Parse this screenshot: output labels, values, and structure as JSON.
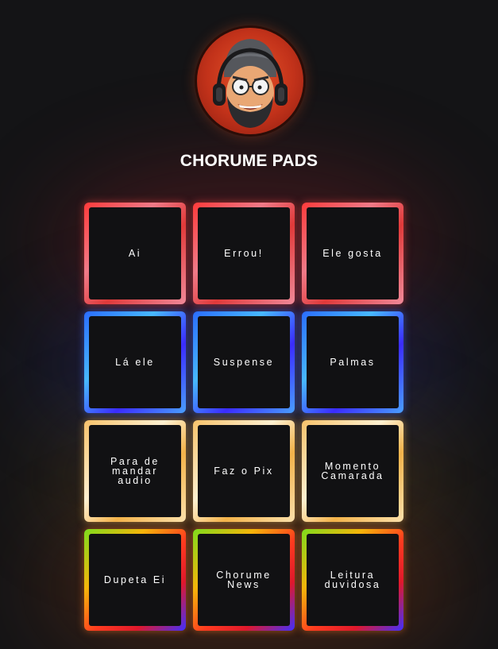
{
  "app": {
    "title": "CHORUME PADS"
  },
  "avatar": {
    "icon": "cartoon-gamer-avatar-icon"
  },
  "pads": [
    {
      "label": "Ai",
      "theme": "red"
    },
    {
      "label": "Errou!",
      "theme": "red"
    },
    {
      "label": "Ele gosta",
      "theme": "red"
    },
    {
      "label": "Lá ele",
      "theme": "blue"
    },
    {
      "label": "Suspense",
      "theme": "blue"
    },
    {
      "label": "Palmas",
      "theme": "blue"
    },
    {
      "label": "Para de mandar audio",
      "theme": "gold"
    },
    {
      "label": "Faz o Pix",
      "theme": "gold"
    },
    {
      "label": "Momento Camarada",
      "theme": "gold"
    },
    {
      "label": "Dupeta Ei",
      "theme": "rainbow"
    },
    {
      "label": "Chorume News",
      "theme": "rainbow"
    },
    {
      "label": "Leitura duvidosa",
      "theme": "rainbow"
    }
  ],
  "colors": {
    "background": "#141416",
    "pad_face": "#111113",
    "text": "#ffffff",
    "red": "#ff3a3a",
    "blue": "#2a6cff",
    "gold": "#f7c26a",
    "rainbow": "#ff7a20"
  }
}
